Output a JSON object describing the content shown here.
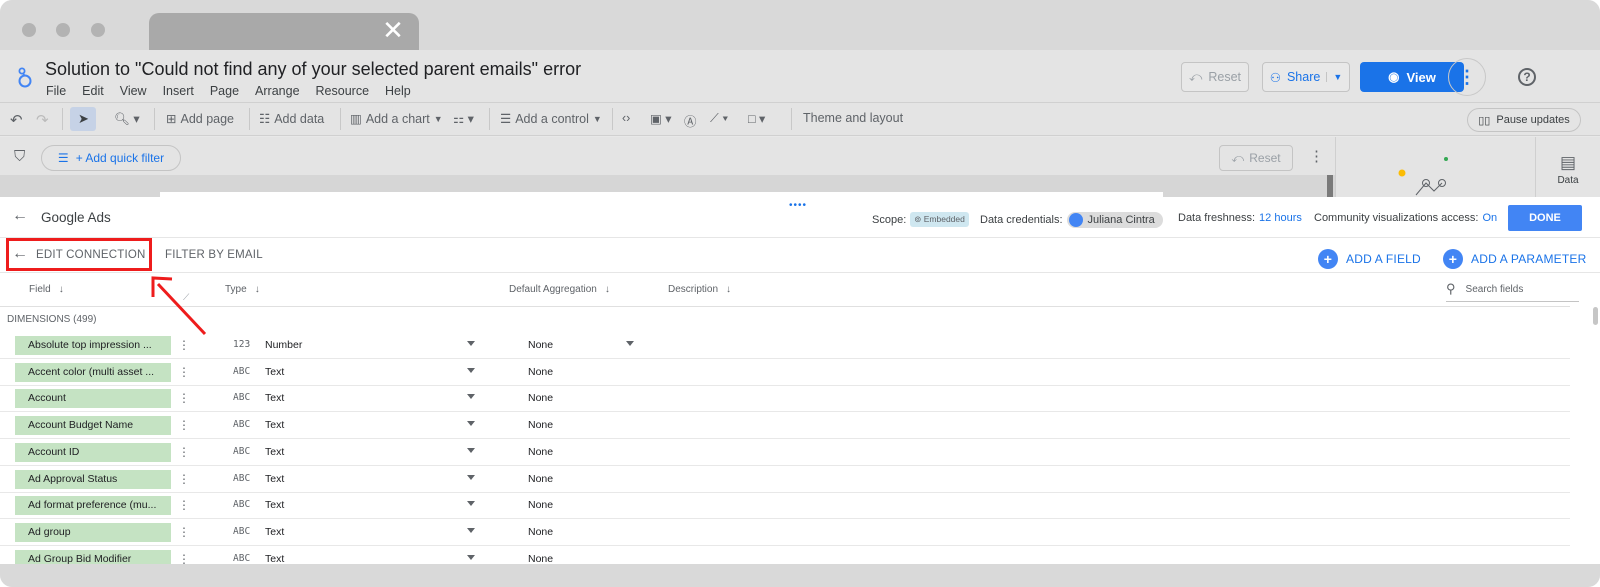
{
  "browser": {
    "tab_close_glyph": "✕"
  },
  "app": {
    "title": "Solution to \"Could not find any of your selected parent emails\" error",
    "menu": [
      "File",
      "Edit",
      "View",
      "Insert",
      "Page",
      "Arrange",
      "Resource",
      "Help"
    ],
    "reset_label": "Reset",
    "share_label": "Share",
    "view_label": "View",
    "accent_color": "#1a73e8"
  },
  "toolbar": {
    "add_page": "Add page",
    "add_data": "Add data",
    "add_chart": "Add a chart",
    "add_control": "Add a control",
    "theme_layout": "Theme and layout",
    "pause_updates": "Pause updates"
  },
  "filterbar": {
    "quick_filter": "+ Add quick filter",
    "reset_label": "Reset"
  },
  "side_panel": {
    "data_tab": "Data"
  },
  "connection": {
    "source_name": "Google Ads",
    "scope_label": "Scope:",
    "scope_value": "Embedded",
    "credentials_label": "Data credentials:",
    "credentials_user": "Juliana Cintra",
    "freshness_label": "Data freshness:",
    "freshness_value": "12 hours",
    "community_label": "Community visualizations access:",
    "community_value": "On",
    "done_label": "DONE",
    "edit_connection": "EDIT CONNECTION",
    "filter_by_email": "FILTER BY EMAIL",
    "add_field": "ADD A FIELD",
    "add_parameter": "ADD A PARAMETER",
    "search_placeholder": "Search fields",
    "columns": {
      "field": "Field",
      "type": "Type",
      "default_aggregation": "Default Aggregation",
      "description": "Description"
    },
    "dimensions_label": "DIMENSIONS (499)",
    "rows": [
      {
        "field": "Absolute top impression ...",
        "type_icon": "123",
        "type": "Number",
        "aggregation": "None",
        "agg_dropdown": true
      },
      {
        "field": "Accent color (multi asset ...",
        "type_icon": "ABC",
        "type": "Text",
        "aggregation": "None",
        "agg_dropdown": false
      },
      {
        "field": "Account",
        "type_icon": "ABC",
        "type": "Text",
        "aggregation": "None",
        "agg_dropdown": false
      },
      {
        "field": "Account Budget Name",
        "type_icon": "ABC",
        "type": "Text",
        "aggregation": "None",
        "agg_dropdown": false
      },
      {
        "field": "Account ID",
        "type_icon": "ABC",
        "type": "Text",
        "aggregation": "None",
        "agg_dropdown": false
      },
      {
        "field": "Ad Approval Status",
        "type_icon": "ABC",
        "type": "Text",
        "aggregation": "None",
        "agg_dropdown": false
      },
      {
        "field": "Ad format preference (mu...",
        "type_icon": "ABC",
        "type": "Text",
        "aggregation": "None",
        "agg_dropdown": false
      },
      {
        "field": "Ad group",
        "type_icon": "ABC",
        "type": "Text",
        "aggregation": "None",
        "agg_dropdown": false
      },
      {
        "field": "Ad Group Bid Modifier",
        "type_icon": "ABC",
        "type": "Text",
        "aggregation": "None",
        "agg_dropdown": false
      }
    ]
  },
  "annotation": {
    "highlight_color": "#ee1c1c"
  }
}
